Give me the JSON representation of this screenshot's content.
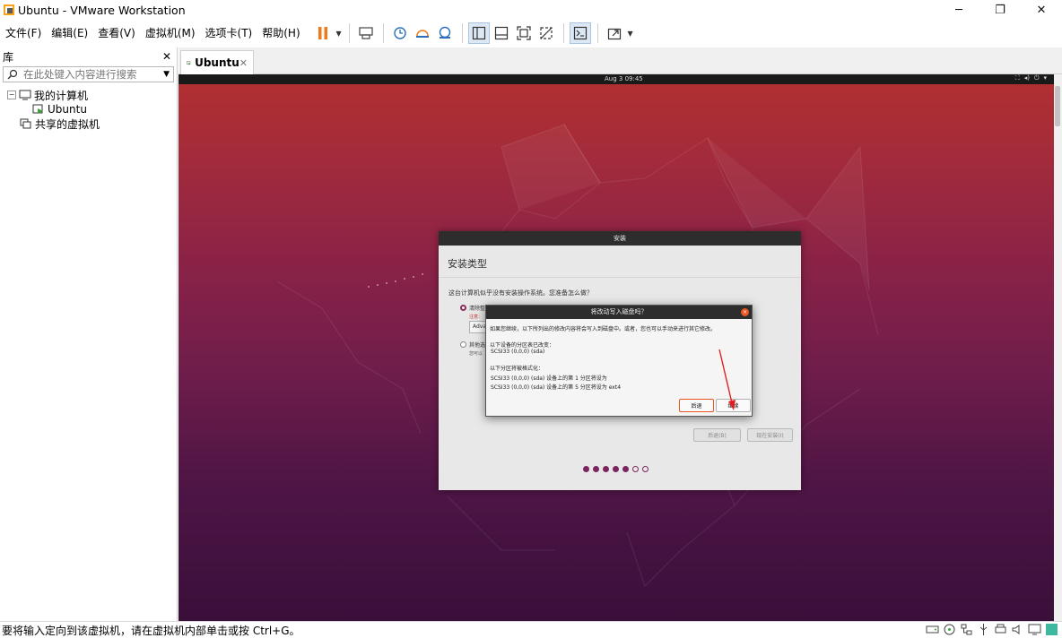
{
  "window": {
    "title": "Ubuntu - VMware Workstation",
    "controls": {
      "minimize": "─",
      "maximize": "❐",
      "close": "✕"
    }
  },
  "menu": {
    "items": [
      "文件(F)",
      "编辑(E)",
      "查看(V)",
      "虚拟机(M)",
      "选项卡(T)",
      "帮助(H)"
    ]
  },
  "library": {
    "title": "库",
    "close": "✕",
    "search_placeholder": "在此处键入内容进行搜索",
    "tree": {
      "my_computer": "我的计算机",
      "vm": "Ubuntu",
      "shared": "共享的虚拟机",
      "toggle": "−"
    }
  },
  "tab": {
    "label": "Ubuntu",
    "close": "✕"
  },
  "guest": {
    "clock": "Aug 3  09:45",
    "sys_icons": [
      "⛶",
      "◂)",
      "⏻",
      "▾"
    ]
  },
  "installer": {
    "header": "安装",
    "title": "安装类型",
    "question": "这台计算机似乎没有安装操作系统。您准备怎么做？",
    "option1": "清除整",
    "option1_note": "注意：",
    "advanced": "Adva",
    "option2": "其他选",
    "option2_note": "您可以",
    "btn_back": "后退(B)",
    "btn_install": "现在安装(I)",
    "progress": {
      "done": 5,
      "total": 7
    }
  },
  "dialog": {
    "title": "将改动写入磁盘吗？",
    "close": "×",
    "intro": "如果您继续，以下所列出的修改内容将会写入到磁盘中。或者，您也可以手动来进行其它修改。",
    "changed_heading": "以下设备的分区表已改变：",
    "changed_device": "SCSI33 (0,0,0) (sda)",
    "format_heading": "以下分区将被格式化：",
    "format_line1": "SCSI33 (0,0,0) (sda) 设备上的第 1 分区将设为",
    "format_line2": "SCSI33 (0,0,0) (sda) 设备上的第 5 分区将设为 ext4",
    "btn_back": "后退",
    "btn_continue": "继续"
  },
  "status": {
    "text": "要将输入定向到该虚拟机，请在虚拟机内部单击或按 Ctrl+G。"
  },
  "colors": {
    "ubuntu_orange": "#e95420",
    "aubergine": "#7a2560",
    "pause_orange": "#f07a1a",
    "toolbar_blue": "#2a6fb8"
  }
}
